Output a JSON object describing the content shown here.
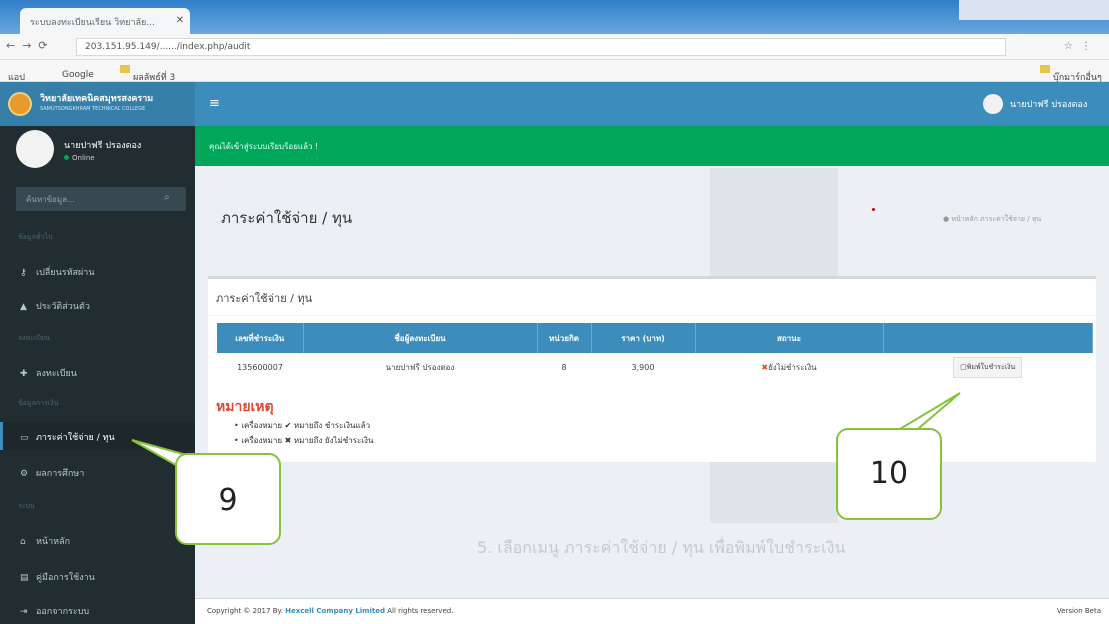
{
  "browser": {
    "tab_title": "ระบบลงทะเบียนเรียน วิทยาลัย...",
    "url": "203.151.95.149/....../index.php/audit",
    "bookmarks": [
      "แอป",
      "Google",
      "ผลลัพธ์ที่ 3"
    ],
    "other_bookmarks": "บุ๊กมาร์กอื่นๆ"
  },
  "header": {
    "logo_title": "วิทยาลัยเทคนิคสมุทรสงคราม",
    "logo_subtitle": "SAMUTSONGKHRAM TECHNICAL COLLEGE",
    "menu_icon": "hamburger-icon",
    "user_name": "นายปาฟรี ปรองดอง"
  },
  "sidebar": {
    "user_name": "นายปาฟรี ปรองดอง",
    "status": "Online",
    "search_placeholder": "ค้นหาข้อมูล...",
    "section_1": "ข้อมูลทั่วไป",
    "section_2": "ลงทะเบียน",
    "section_3": "ข้อมูลการเงิน",
    "section_4": "ระบบ",
    "items": [
      {
        "label": "เปลี่ยนรหัสผ่าน",
        "icon": "key-icon"
      },
      {
        "label": "ประวัติส่วนตัว",
        "icon": "user-icon"
      },
      {
        "label": "ลงทะเบียน",
        "icon": "plus-icon"
      },
      {
        "label": "ภาระค่าใช้จ่าย / ทุน",
        "icon": "card-icon"
      },
      {
        "label": "ผลการศึกษา",
        "icon": "gear-icon"
      },
      {
        "label": "หน้าหลัก",
        "icon": "home-icon"
      },
      {
        "label": "คู่มือการใช้งาน",
        "icon": "book-icon"
      },
      {
        "label": "ออกจากระบบ",
        "icon": "signout-icon"
      }
    ]
  },
  "content": {
    "alert_text": "คุณได้เข้าสู่ระบบเรียบร้อยแล้ว !",
    "page_title": "ภาระค่าใช้จ่าย / ทุน",
    "breadcrumb": "● หน้าหลัก  ภาระค่าใช้จ่าย / ทุน",
    "box_title": "ภาระค่าใช้จ่าย / ทุน",
    "table": {
      "headers": [
        "เลขที่ชำระเงิน",
        "ชื่อผู้ลงทะเบียน",
        "หน่วยกิต",
        "ราคา (บาท)",
        "สถานะ",
        ""
      ],
      "rows": [
        {
          "receipt_no": "135600007",
          "name": "นายปาฟรี ปรองดอง",
          "credits": "8",
          "price": "3,900",
          "status": "ยังไม่ชำระเงิน",
          "action": "พิมพ์ใบชำระเงิน"
        }
      ]
    },
    "note_title": "หมายเหตุ",
    "note_paid": "เครื่องหมาย ✔ หมายถึง ชำระเงินแล้ว",
    "note_unpaid": "เครื่องหมาย ✖ หมายถึง ยังไม่ชำระเงิน",
    "footer_prefix": "Copyright © 2017 By.",
    "footer_company": "Hexcell Company Limited",
    "footer_suffix": "All rights reserved.",
    "version": "Version Beta",
    "background_caption": "5.  เลือกเมนู ภาระค่าใช้จ่าย / ทุน  เพื่อพิมพ์ใบชำระเงิน"
  },
  "annotations": {
    "callout_1": "9",
    "callout_2": "10",
    "callout_border_color": "#86c23d"
  }
}
